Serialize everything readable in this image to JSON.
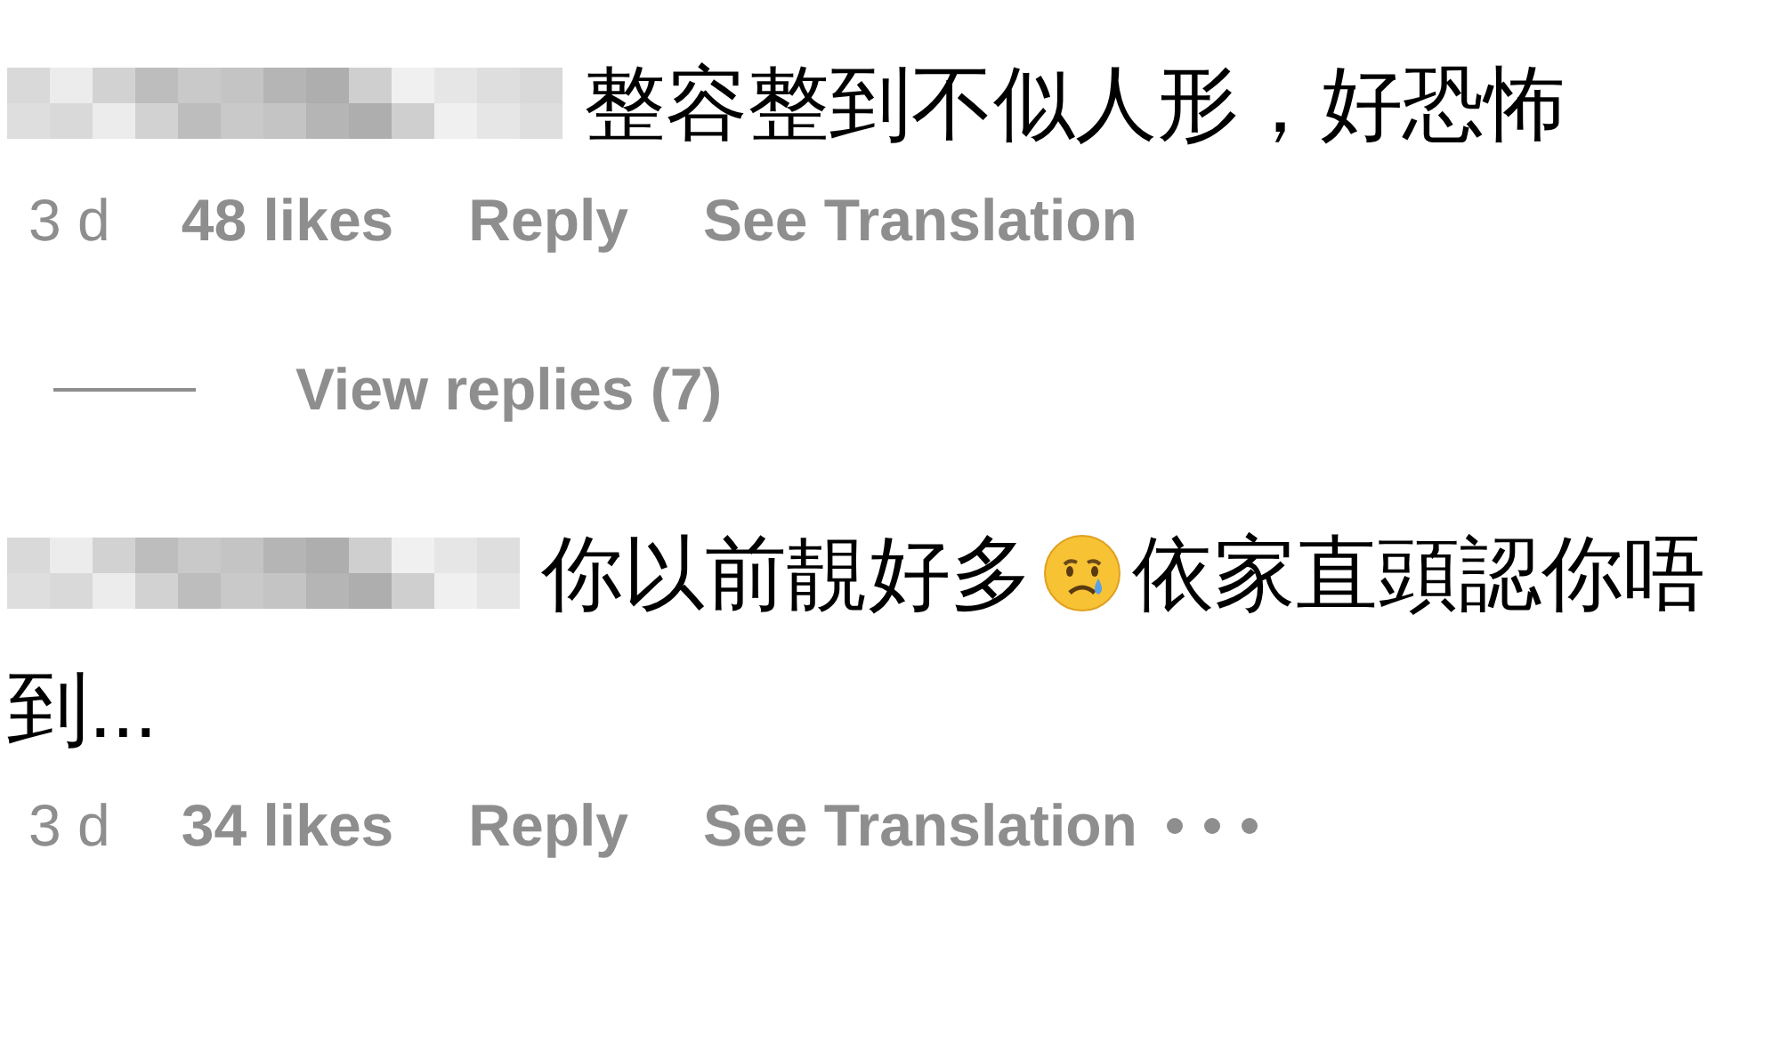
{
  "comments": [
    {
      "segments": [
        {
          "kind": "text",
          "text": "整容整到不似人形，好恐怖"
        }
      ],
      "time": "3 d",
      "likes": "48 likes",
      "reply": "Reply",
      "translation": "See Translation",
      "more": false,
      "view_replies": "View replies (7)"
    },
    {
      "segments": [
        {
          "kind": "text",
          "text": "你以前靚好多"
        },
        {
          "kind": "emoji"
        },
        {
          "kind": "text",
          "text": "依家直頭認你唔"
        },
        {
          "kind": "text",
          "text": "到..."
        }
      ],
      "time": "3 d",
      "likes": "34 likes",
      "reply": "Reply",
      "translation": "See Translation",
      "more": true
    }
  ]
}
